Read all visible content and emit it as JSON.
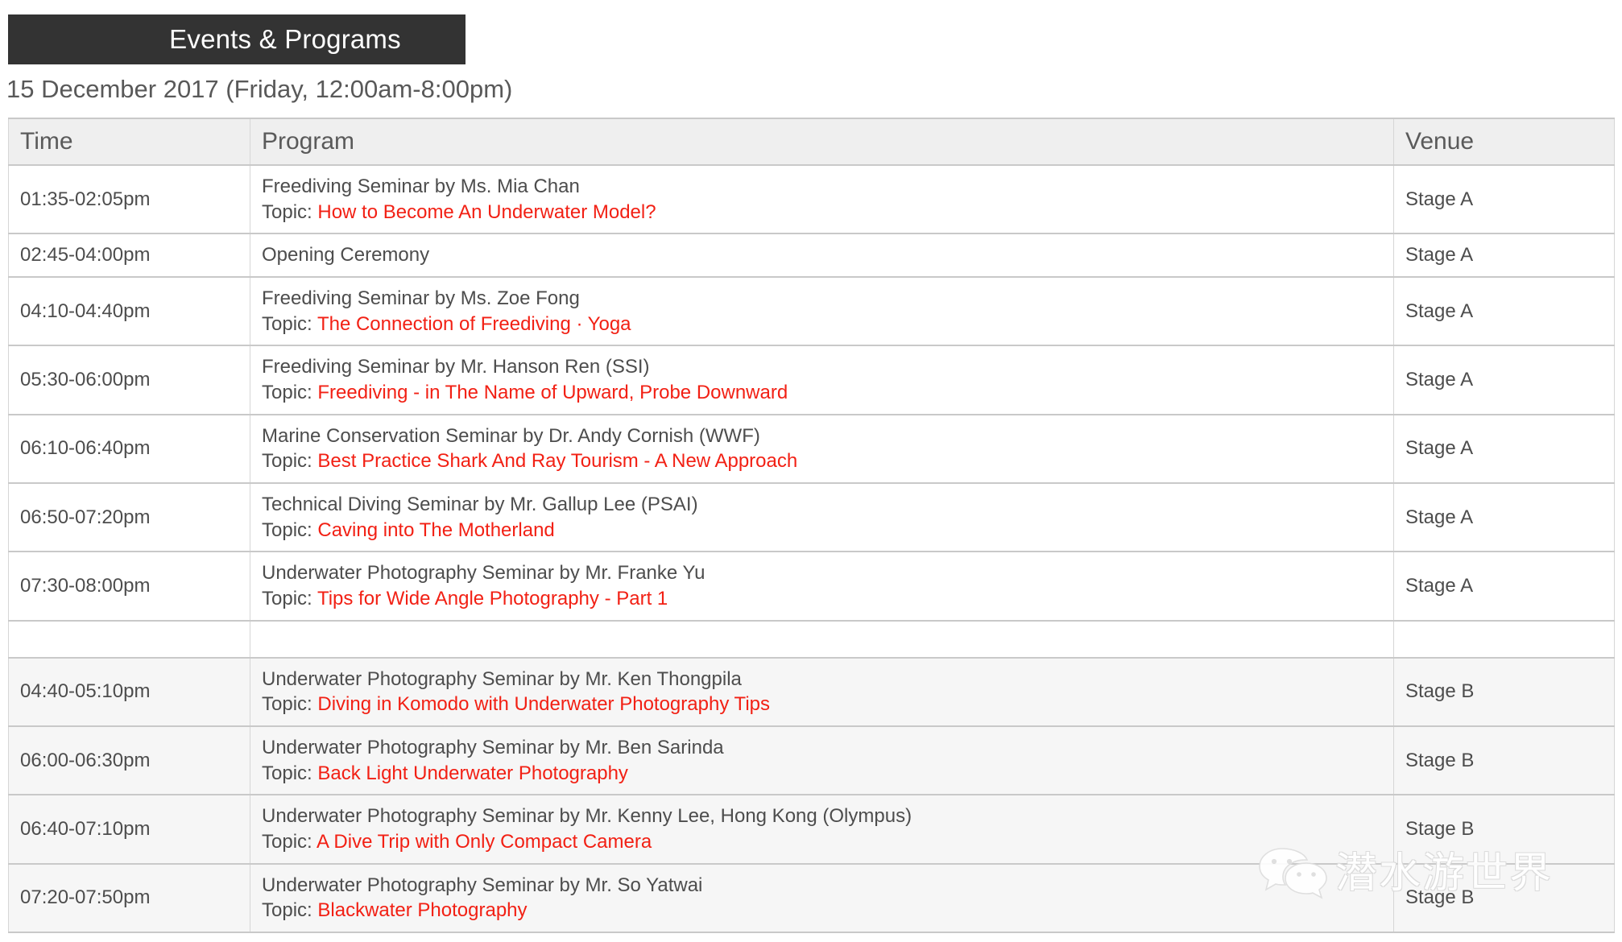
{
  "banner": {
    "title": "Events & Programs"
  },
  "date_line": "15 December 2017 (Friday, 12:00am-8:00pm)",
  "table": {
    "headers": {
      "time": "Time",
      "program": "Program",
      "venue": "Venue"
    },
    "topic_label": "Topic:",
    "rows": [
      {
        "time": "01:35-02:05pm",
        "title": "Freediving Seminar by Ms. Mia Chan",
        "topic": "How to Become An Underwater Model?",
        "venue": "Stage A",
        "shaded": false
      },
      {
        "time": "02:45-04:00pm",
        "title": "Opening Ceremony",
        "topic": "",
        "venue": "Stage A",
        "shaded": false
      },
      {
        "time": "04:10-04:40pm",
        "title": "Freediving Seminar by Ms. Zoe Fong",
        "topic": "The Connection of Freediving · Yoga",
        "venue": "Stage A",
        "shaded": false
      },
      {
        "time": "05:30-06:00pm",
        "title": "Freediving Seminar by Mr. Hanson Ren (SSI)",
        "topic": "Freediving - in The Name of Upward, Probe Downward",
        "venue": "Stage A",
        "shaded": false
      },
      {
        "time": "06:10-06:40pm",
        "title": "Marine Conservation Seminar by Dr. Andy Cornish (WWF)",
        "topic": "Best Practice Shark And Ray Tourism - A New Approach",
        "venue": "Stage A",
        "shaded": false
      },
      {
        "time": "06:50-07:20pm",
        "title": "Technical Diving Seminar by Mr. Gallup Lee (PSAI)",
        "topic": "Caving into The Motherland",
        "venue": "Stage A",
        "shaded": false
      },
      {
        "time": "07:30-08:00pm",
        "title": "Underwater Photography Seminar by Mr. Franke Yu",
        "topic": "Tips for Wide Angle Photography - Part 1",
        "venue": "Stage A",
        "shaded": false
      },
      {
        "time": "",
        "title": "",
        "topic": "",
        "venue": "",
        "shaded": false,
        "spacer": true
      },
      {
        "time": "04:40-05:10pm",
        "title": "Underwater Photography Seminar by Mr. Ken Thongpila",
        "topic": "Diving in Komodo with Underwater Photography Tips",
        "venue": "Stage B",
        "shaded": true
      },
      {
        "time": "06:00-06:30pm",
        "title": "Underwater Photography Seminar by Mr. Ben Sarinda",
        "topic": "Back Light Underwater Photography",
        "venue": "Stage B",
        "shaded": true
      },
      {
        "time": "06:40-07:10pm",
        "title": "Underwater Photography Seminar by Mr. Kenny Lee, Hong Kong (Olympus)",
        "topic": "A Dive Trip with Only Compact Camera",
        "venue": "Stage B",
        "shaded": true
      },
      {
        "time": "07:20-07:50pm",
        "title": "Underwater Photography Seminar by Mr. So Yatwai",
        "topic": "Blackwater Photography",
        "venue": "Stage B",
        "shaded": true
      }
    ]
  },
  "watermark": {
    "icon": "wechat-icon",
    "text": "潜水游世界"
  },
  "colors": {
    "banner_background": "#333333",
    "topic_red": "#f22014",
    "body_text": "#4d4d4d",
    "header_background": "#efefef",
    "border": "#c9c9c9",
    "shaded_row": "#f6f6f6"
  }
}
